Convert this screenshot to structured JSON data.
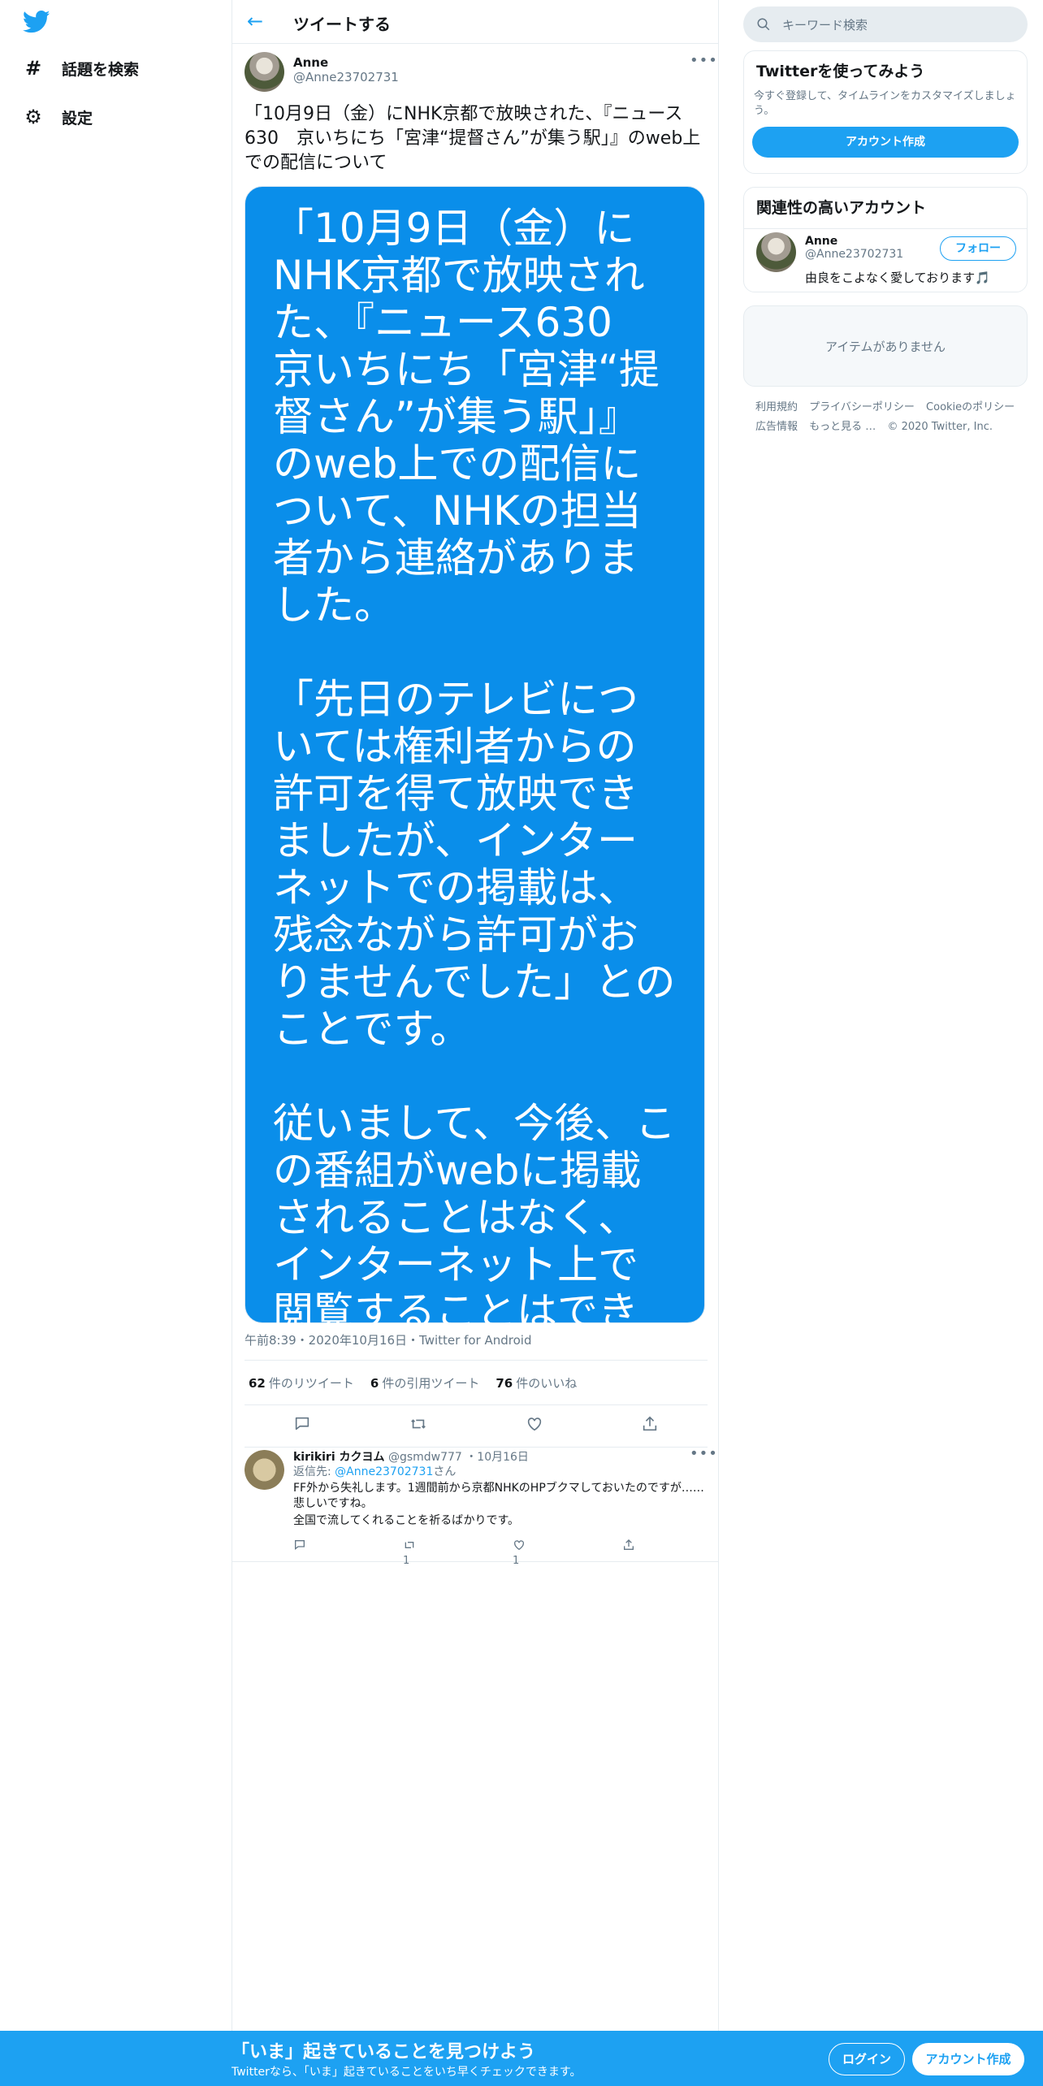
{
  "nav": {
    "explore": "話題を検索",
    "settings": "設定"
  },
  "header": {
    "title": "ツイートする"
  },
  "tweet": {
    "name": "Anne",
    "handle": "@Anne23702731",
    "text": "「10月9日（金）にNHK京都で放映された、『ニュース630　京いちにち「宮津“提督さん”が集う駅」』のweb上での配信について",
    "image_paragraphs": [
      "「10月9日（金）にNHK京都で放映された、『ニュース630　京いちにち「宮津“提督さん”が集う駅」』のweb上での配信について、NHKの担当者から連絡がありました。",
      "「先日のテレビについては権利者からの許可を得て放映できましたが、インターネットでの掲載は、残念ながら許可がおりませんでした」とのことです。",
      "従いまして、今後、この番組がwebに掲載されることはなく、インターネット上で閲覧することはできません。"
    ],
    "meta": "午前8:39・2020年10月16日・Twitter for Android",
    "retweets": "62",
    "retweets_label": "件のリツイート",
    "quotes": "6",
    "quotes_label": "件の引用ツイート",
    "likes": "76",
    "likes_label": "件のいいね"
  },
  "reply": {
    "name": "kirikiri カクヨム",
    "handle": "@gsmdw777",
    "date": "・10月16日",
    "reply_to_prefix": "返信先: ",
    "reply_to_handle": "@Anne23702731",
    "reply_to_suffix": "さん",
    "line1": "FF外から失礼します。1週間前から京都NHKのHPブクマしておいたのですが……　悲しいですね。",
    "line2": "全国で流してくれることを祈るばかりです。",
    "retweets": "1",
    "likes": "1"
  },
  "sidebar": {
    "search_placeholder": "キーワード検索",
    "try_title": "Twitterを使ってみよう",
    "try_desc": "今すぐ登録して、タイムラインをカスタマイズしましょう。",
    "create_account": "アカウント作成",
    "related_title": "関連性の高いアカウント",
    "related_name": "Anne",
    "related_handle": "@Anne23702731",
    "follow": "フォロー",
    "related_bio": "由良をこよなく愛しております🎵",
    "trends_empty": "アイテムがありません",
    "footer": [
      "利用規約",
      "プライバシーポリシー",
      "Cookieのポリシー",
      "広告情報",
      "もっと見る …",
      "© 2020 Twitter, Inc."
    ]
  },
  "bottom": {
    "title": "「いま」起きていることを見つけよう",
    "subtitle": "Twitterなら、「いま」起きていることをいち早くチェックできます。",
    "login": "ログイン",
    "signup": "アカウント作成"
  },
  "colors": {
    "accent": "#1da1f2",
    "image_bg": "#0a8eea"
  }
}
